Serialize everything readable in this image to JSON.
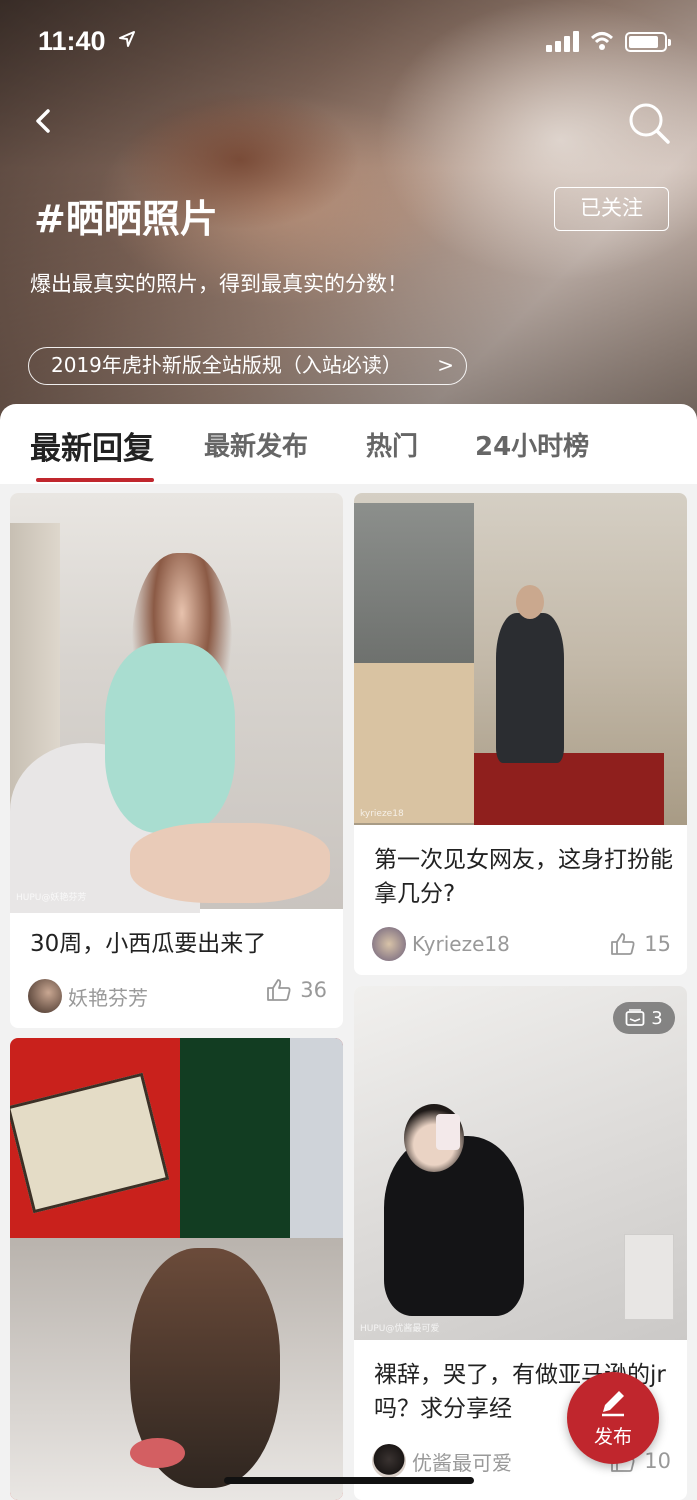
{
  "status_bar": {
    "time": "11:40",
    "battery_level": 0.85
  },
  "header": {
    "topic_title": "#晒晒照片",
    "follow_label": "已关注",
    "description": "爆出最真实的照片，得到最真实的分数！",
    "rules_link": "2019年虎扑新版全站版规（入站必读）",
    "rules_arrow": ">"
  },
  "tabs": [
    {
      "label": "最新回复",
      "active": true
    },
    {
      "label": "最新发布",
      "active": false
    },
    {
      "label": "热门",
      "active": false
    },
    {
      "label": "24小时榜",
      "active": false
    }
  ],
  "posts": [
    {
      "title": "30周，小西瓜要出来了",
      "author": "妖艳芬芳",
      "likes": "36",
      "watermark": "HUPU@妖艳芬芳"
    },
    {
      "title": "第一次见女网友，这身打扮能拿几分?",
      "author": "Kyrieze18",
      "likes": "15",
      "watermark": "kyrieze18"
    },
    {
      "title": "",
      "author": "",
      "likes": ""
    },
    {
      "title": "裸辞，哭了，有做亚马逊的jr吗？求分享经",
      "author": "优酱最可爱",
      "likes": "10",
      "image_count": "3",
      "watermark": "HUPU@优酱最可爱"
    }
  ],
  "fab": {
    "label": "发布"
  },
  "colors": {
    "accent": "#c0262d"
  }
}
